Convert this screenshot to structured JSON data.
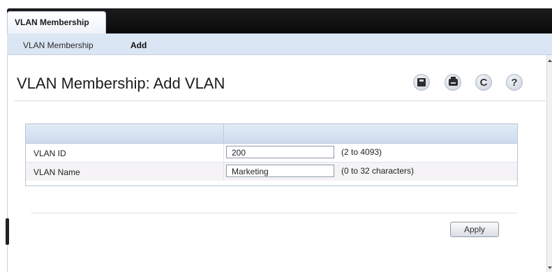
{
  "tabbar": {
    "active_tab": "VLAN Membership"
  },
  "subnav": {
    "items": [
      {
        "label": "VLAN Membership"
      },
      {
        "label": "Add"
      }
    ]
  },
  "page": {
    "title": "VLAN Membership: Add VLAN"
  },
  "toolbar": {
    "icons": [
      "save-icon",
      "print-icon",
      "refresh-icon",
      "help-icon"
    ],
    "refresh_glyph": "C",
    "help_glyph": "?"
  },
  "form": {
    "rows": [
      {
        "label": "VLAN ID",
        "value": "200",
        "hint": "(2 to 4093)"
      },
      {
        "label": "VLAN Name",
        "value": "Marketing",
        "hint": "(0 to 32 characters)"
      }
    ],
    "apply_label": "Apply"
  },
  "colors": {
    "tabbar_bg": "#111111",
    "subnav_bg": "#dbe6f4",
    "table_header": "#d6e2f2"
  }
}
